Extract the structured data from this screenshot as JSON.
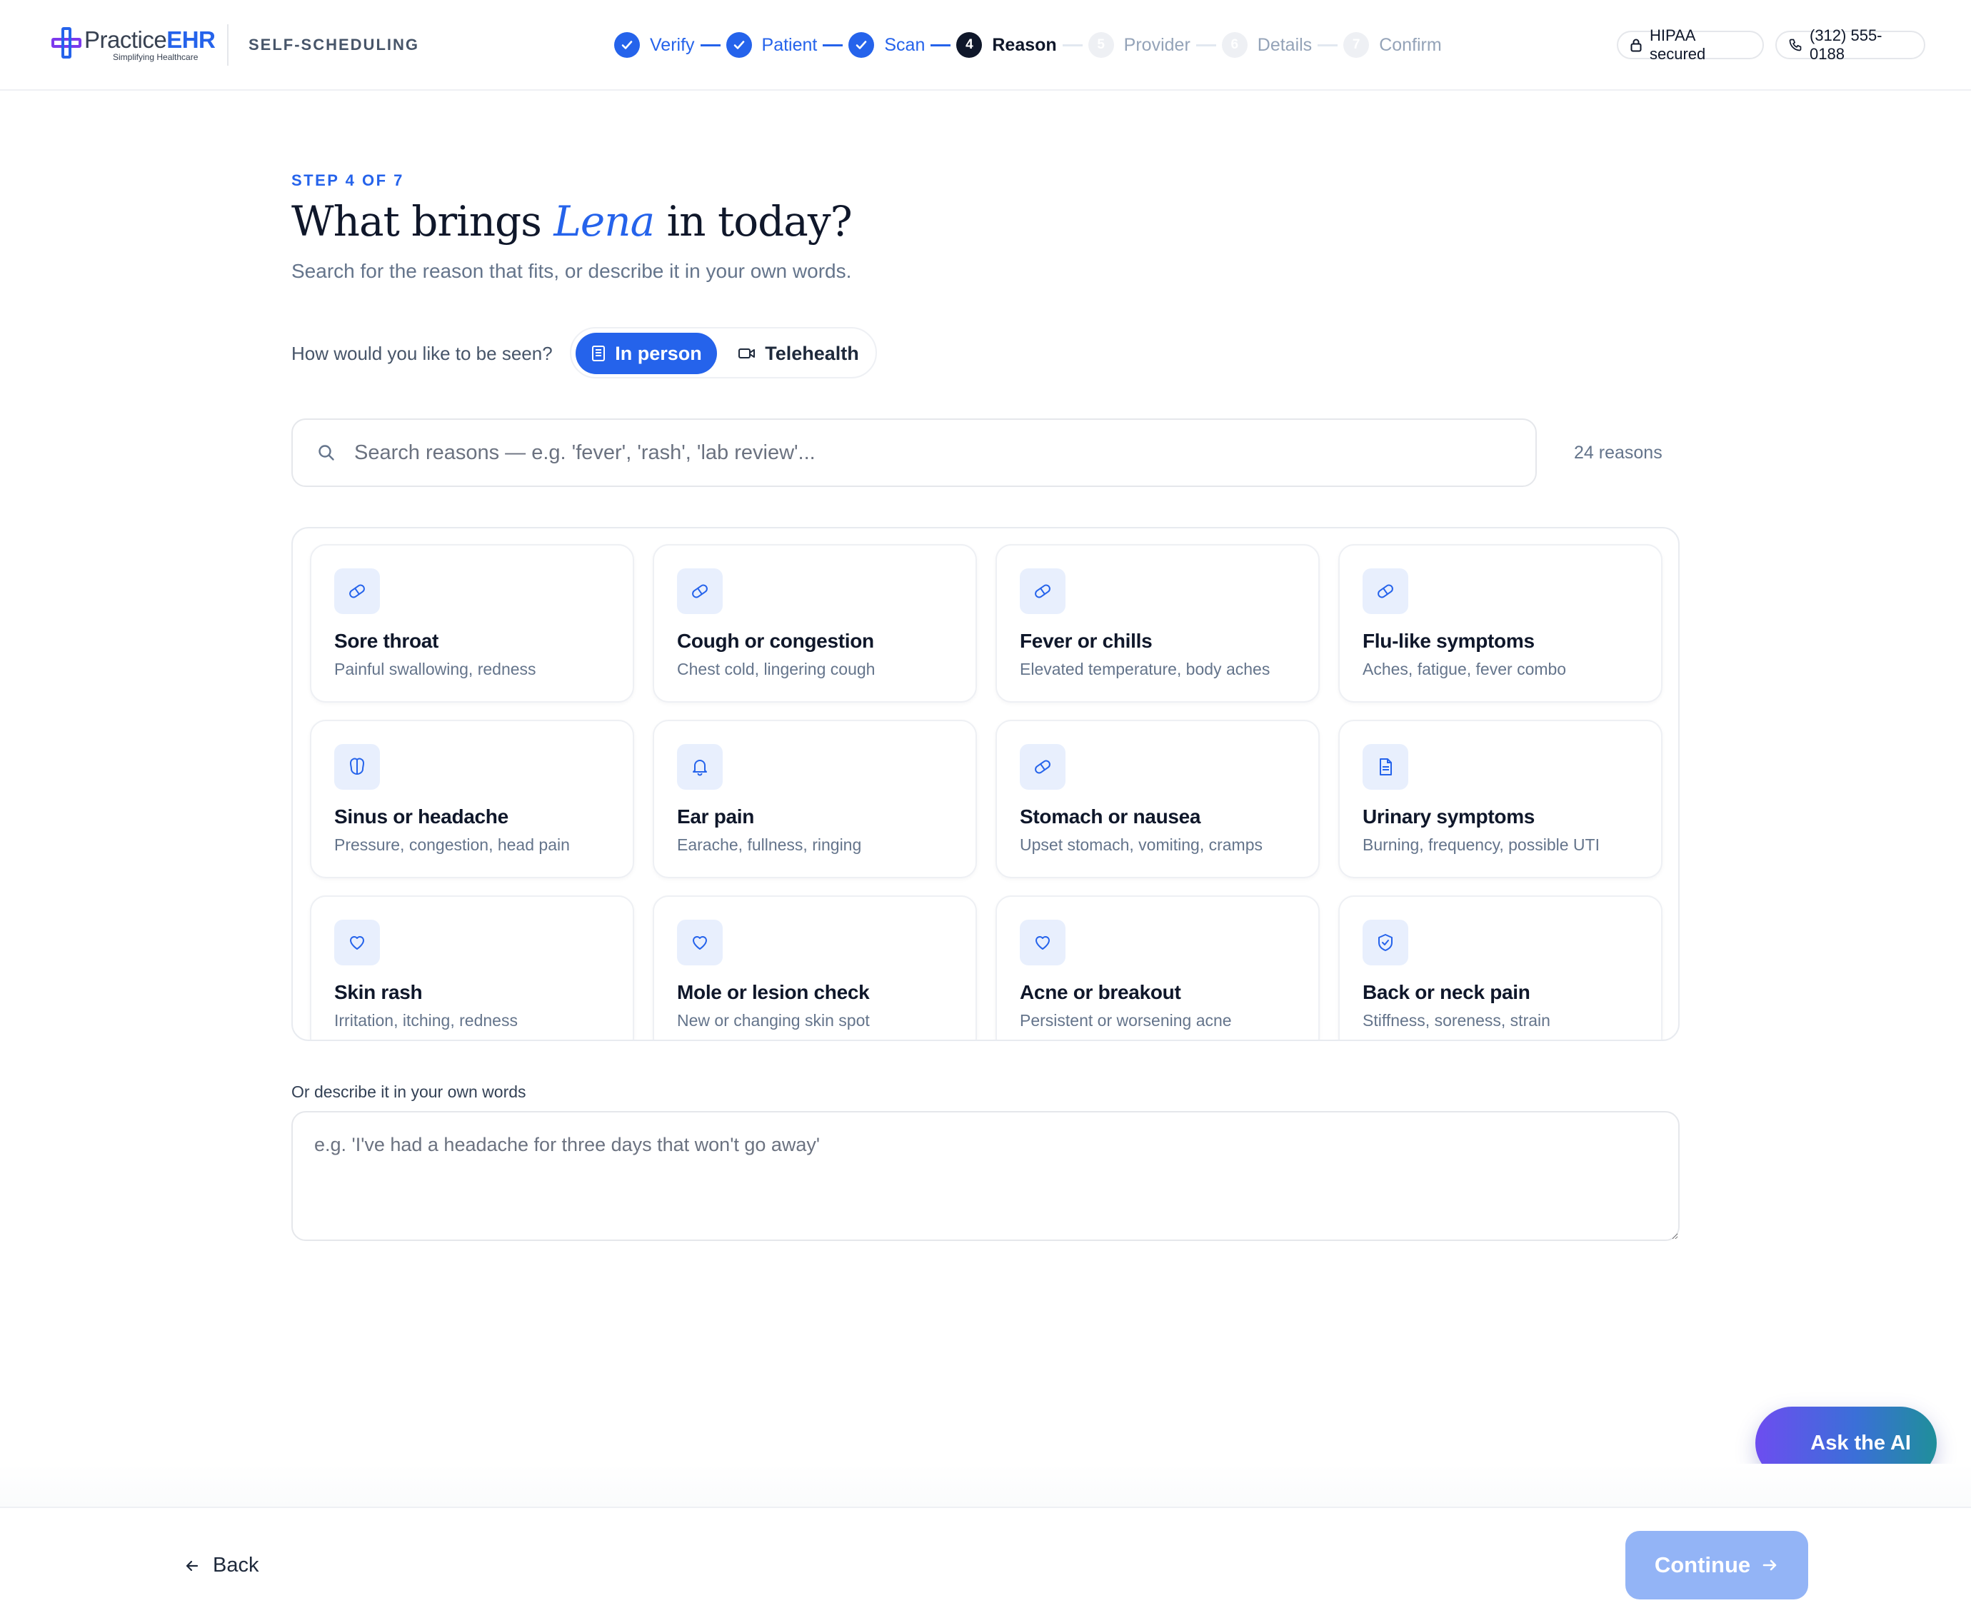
{
  "app": {
    "logo_word_a": "Practice",
    "logo_word_b": "EHR",
    "logo_tagline": "Simplifying Healthcare",
    "section": "SELF-SCHEDULING"
  },
  "stepper": {
    "steps": [
      {
        "number": "1",
        "label": "Verify",
        "state": "done"
      },
      {
        "number": "2",
        "label": "Patient",
        "state": "done"
      },
      {
        "number": "3",
        "label": "Scan",
        "state": "done"
      },
      {
        "number": "4",
        "label": "Reason",
        "state": "current"
      },
      {
        "number": "5",
        "label": "Provider",
        "state": "todo"
      },
      {
        "number": "6",
        "label": "Details",
        "state": "todo"
      },
      {
        "number": "7",
        "label": "Confirm",
        "state": "todo"
      }
    ]
  },
  "header": {
    "hipaa": "HIPAA secured",
    "phone": "(312) 555-0188"
  },
  "page": {
    "eyebrow": "STEP 4 OF 7",
    "title_pre": "What brings ",
    "title_name": "Lena",
    "title_post": " in today?",
    "subtitle": "Search for the reason that fits, or describe it in your own words."
  },
  "modality": {
    "label": "How would you like to be seen?",
    "options": [
      "In person",
      "Telehealth"
    ],
    "selected": "In person"
  },
  "search": {
    "placeholder": "Search reasons — e.g. 'fever', 'rash', 'lab review'...",
    "value": "",
    "count": "24 reasons"
  },
  "reasons": [
    {
      "title": "Sore throat",
      "desc": "Painful swallowing, redness",
      "icon": "pill-icon"
    },
    {
      "title": "Cough or congestion",
      "desc": "Chest cold, lingering cough",
      "icon": "pill-icon"
    },
    {
      "title": "Fever or chills",
      "desc": "Elevated temperature, body aches",
      "icon": "pill-icon"
    },
    {
      "title": "Flu-like symptoms",
      "desc": "Aches, fatigue, fever combo",
      "icon": "pill-icon"
    },
    {
      "title": "Sinus or headache",
      "desc": "Pressure, congestion, head pain",
      "icon": "brain-icon"
    },
    {
      "title": "Ear pain",
      "desc": "Earache, fullness, ringing",
      "icon": "bell-icon"
    },
    {
      "title": "Stomach or nausea",
      "desc": "Upset stomach, vomiting, cramps",
      "icon": "pill-icon"
    },
    {
      "title": "Urinary symptoms",
      "desc": "Burning, frequency, possible UTI",
      "icon": "document-icon"
    },
    {
      "title": "Skin rash",
      "desc": "Irritation, itching, redness",
      "icon": "heart-icon"
    },
    {
      "title": "Mole or lesion check",
      "desc": "New or changing skin spot",
      "icon": "heart-icon"
    },
    {
      "title": "Acne or breakout",
      "desc": "Persistent or worsening acne",
      "icon": "heart-icon"
    },
    {
      "title": "Back or neck pain",
      "desc": "Stiffness, soreness, strain",
      "icon": "shield-check-icon"
    }
  ],
  "own_words": {
    "label": "Or describe it in your own words",
    "placeholder": "e.g. 'I've had a headache for three days that won't go away'",
    "value": ""
  },
  "ask_ai": "Ask the AI",
  "footer": {
    "back": "Back",
    "continue": "Continue"
  },
  "colors": {
    "accent": "#2563eb",
    "ink": "#0f172a",
    "muted": "#64748b",
    "continue_disabled": "#93b4f6"
  }
}
